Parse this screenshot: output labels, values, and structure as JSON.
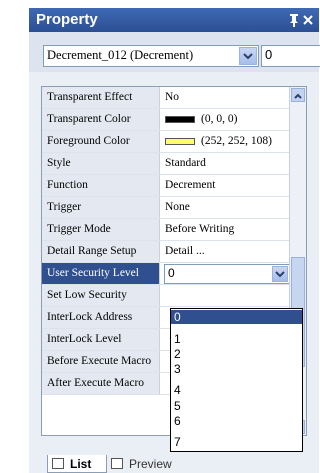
{
  "window": {
    "title": "Property"
  },
  "selector": {
    "object_value": "Decrement_012 (Decrement)",
    "number_value": "0"
  },
  "properties": [
    {
      "name": "Transparent Effect",
      "value": "No"
    },
    {
      "name": "Transparent Color",
      "value": "(0, 0, 0)",
      "swatch": "#000000"
    },
    {
      "name": "Foreground Color",
      "value": "(252, 252, 108)",
      "swatch": "#fcfc6c"
    },
    {
      "name": "Style",
      "value": "Standard"
    },
    {
      "name": "Function",
      "value": "Decrement"
    },
    {
      "name": "Trigger",
      "value": "None"
    },
    {
      "name": "Trigger Mode",
      "value": "Before Writing"
    },
    {
      "name": "Detail Range Setup",
      "value": "Detail ..."
    },
    {
      "name": "User Security Level",
      "value": "0"
    },
    {
      "name": "Set Low Security",
      "value": ""
    },
    {
      "name": "InterLock Address",
      "value": ""
    },
    {
      "name": "InterLock Level",
      "value": ""
    },
    {
      "name": "Before Execute Macro",
      "value": ""
    },
    {
      "name": "After Execute Macro",
      "value": ""
    }
  ],
  "dropdown_options": [
    "0",
    "1",
    "2",
    "3",
    "4",
    "5",
    "6",
    "7"
  ],
  "tabs": {
    "list": "List",
    "preview": "Preview"
  },
  "colors": {
    "accent": "#2f4f8f",
    "titlebar": "#3a62ab"
  }
}
